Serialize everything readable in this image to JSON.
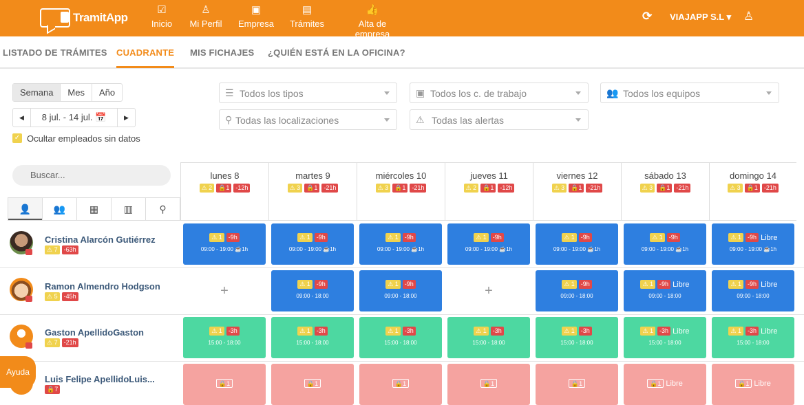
{
  "brand": {
    "name": "TramitApp",
    "accent": "#f28b1a"
  },
  "nav": [
    {
      "label": "Inicio",
      "icon": "check-square-icon"
    },
    {
      "label": "Mi Perfil",
      "icon": "person-icon"
    },
    {
      "label": "Empresa",
      "icon": "briefcase-icon"
    },
    {
      "label": "Trámites",
      "icon": "document-icon"
    },
    {
      "label": "Alta de empresa",
      "icon": "thumbs-up-icon"
    }
  ],
  "company": "VIAJAPP S.L",
  "tabs": [
    "LISTADO DE TRÁMITES",
    "CUADRANTE",
    "MIS FICHAJES",
    "¿QUIÉN ESTÁ EN LA OFICINA?"
  ],
  "period": {
    "options": [
      "Semana",
      "Mes",
      "Año"
    ],
    "selected": "Semana",
    "range": "8 jul. - 14 jul."
  },
  "hide_empty": "Ocultar empleados sin datos",
  "filters": {
    "types": "Todos los tipos",
    "centers": "Todos los c. de trabajo",
    "teams": "Todos los equipos",
    "locations": "Todas las localizaciones",
    "alerts": "Todas las alertas"
  },
  "search_placeholder": "Buscar...",
  "days": [
    {
      "label": "lunes 8",
      "warn": "2",
      "lock": "1",
      "hours": "-12h"
    },
    {
      "label": "martes 9",
      "warn": "3",
      "lock": "1",
      "hours": "-21h"
    },
    {
      "label": "miércoles 10",
      "warn": "3",
      "lock": "1",
      "hours": "-21h"
    },
    {
      "label": "jueves 11",
      "warn": "2",
      "lock": "1",
      "hours": "-12h"
    },
    {
      "label": "viernes 12",
      "warn": "3",
      "lock": "1",
      "hours": "-21h"
    },
    {
      "label": "sábado 13",
      "warn": "3",
      "lock": "1",
      "hours": "-21h"
    },
    {
      "label": "domingo 14",
      "warn": "3",
      "lock": "1",
      "hours": "-21h"
    }
  ],
  "employees": [
    {
      "name": "Cristina Alarcón Gutiérrez",
      "warn": "7",
      "hours": "-63h"
    },
    {
      "name": "Ramon Almendro Hodgson",
      "warn": "5",
      "hours": "-45h"
    },
    {
      "name": "Gaston ApellidoGaston",
      "warn": "7",
      "hours": "-21h"
    },
    {
      "name": "Luis Felipe ApellidoLuis...",
      "lock": "7"
    }
  ],
  "shifts": {
    "row1": {
      "warn": "1",
      "hours": "-9h",
      "time": "09:00 - 19:00",
      "break": "1h",
      "free": "Libre"
    },
    "row2": {
      "warn": "1",
      "hours": "-9h",
      "time": "09:00 - 18:00",
      "free": "Libre"
    },
    "row3": {
      "warn": "1",
      "hours": "-3h",
      "time": "15:00 - 18:00",
      "free": "Libre"
    },
    "row4": {
      "lock": "1",
      "free": "Libre"
    }
  },
  "help": "Ayuda",
  "plus": "+"
}
